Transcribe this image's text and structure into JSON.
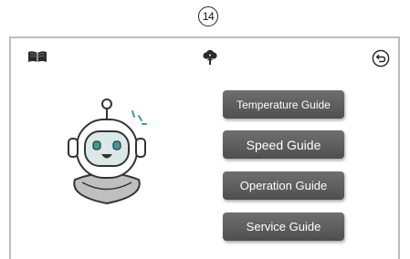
{
  "step_number": "14",
  "header": {
    "left_icon": "book-icon",
    "center_icon": "wifi-cloud-icon",
    "right_icon": "back-icon"
  },
  "mascot": "robot-mascot",
  "menu": {
    "temperature_guide": "Temperature Guide",
    "speed_guide": "Speed Guide",
    "operation_guide": "Operation Guide",
    "service_guide": "Service Guide"
  },
  "colors": {
    "button_bg": "#5e5e5e",
    "button_text": "#ffffff",
    "border": "#bdbdbd"
  }
}
